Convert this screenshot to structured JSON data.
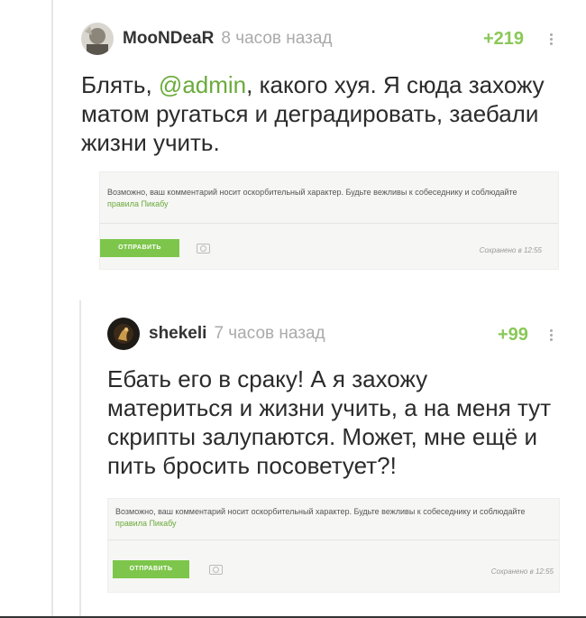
{
  "comments": [
    {
      "username": "MooNDeaR",
      "time": "8 часов назад",
      "rating": "+219",
      "text_before": "Блять, ",
      "mention": "@admin",
      "text_after": ", какого хуя. Я сюда захожу матом ругаться и деградировать, заебали жизни учить.",
      "warning_text": "Возможно, ваш комментарий носит оскорбительный характер. Будьте вежливы к собеседнику и соблюдайте ",
      "warning_link": "правила Пикабу",
      "send_label": "ОТПРАВИТЬ",
      "saved_text": "Сохранено в 12:55"
    },
    {
      "username": "shekeli",
      "time": "7 часов назад",
      "rating": "+99",
      "text": "Ебать его в сраку! А я захожу материться и жизни учить, а на меня тут скрипты залупаются. Может, мне ещё и пить бросить посоветует?!",
      "warning_text": "Возможно, ваш комментарий носит оскорбительный характер. Будьте вежливы к собеседнику и соблюдайте ",
      "warning_link": "правила Пикабу",
      "send_label": "ОТПРАВИТЬ",
      "saved_text": "Сохранено в 12:55"
    }
  ],
  "colors": {
    "accent": "#7dc64b",
    "rating": "#8ac858",
    "mention": "#6aab3a"
  }
}
